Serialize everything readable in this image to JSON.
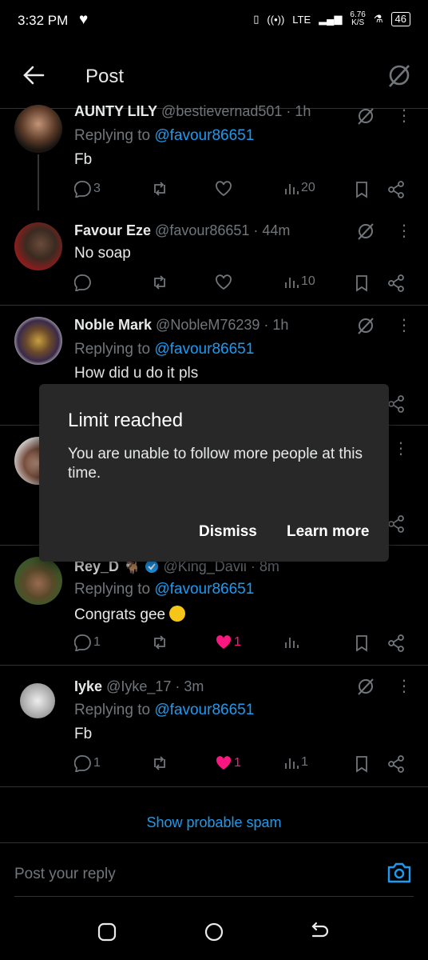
{
  "status": {
    "time": "3:32 PM",
    "net_speed": "6.76",
    "net_unit": "K/S",
    "battery": "46",
    "lte": "LTE"
  },
  "header": {
    "title": "Post"
  },
  "replies": [
    {
      "name": "AUNTY LILY",
      "handle": "@bestievernad501 · 1h",
      "replying_prefix": "Replying to ",
      "mention": "@favour86651",
      "text": "Fb",
      "replies_count": "3",
      "likes_count": "",
      "views_count": "20"
    },
    {
      "name": "Favour Eze",
      "handle": "@favour86651 · 44m",
      "text": "No soap",
      "views_count": "10"
    },
    {
      "name": "Noble Mark",
      "handle": "@NobleM76239 · 1h",
      "replying_prefix": "Replying to ",
      "mention": "@favour86651",
      "text": "How did u do it pls"
    },
    {
      "name": "Rey_D",
      "handle": "@King_Davii · 8m",
      "replying_prefix": "Replying to ",
      "mention": "@favour86651",
      "text": "Congrats gee",
      "replies_count": "1",
      "likes_count": "1"
    },
    {
      "name": "Iyke",
      "handle": "@Iyke_17 · 3m",
      "replying_prefix": "Replying to ",
      "mention": "@favour86651",
      "text": "Fb",
      "replies_count": "1",
      "likes_count": "1",
      "views_count": "1"
    }
  ],
  "dialog": {
    "title": "Limit reached",
    "message": "You are unable to follow more people at this time.",
    "dismiss": "Dismiss",
    "learn_more": "Learn more"
  },
  "spam": {
    "label": "Show probable spam"
  },
  "compose": {
    "placeholder": "Post your reply"
  },
  "colors": {
    "accent": "#1d9bf0",
    "like": "#f91880",
    "muted": "#71767b",
    "dialog_bg": "#282828"
  }
}
